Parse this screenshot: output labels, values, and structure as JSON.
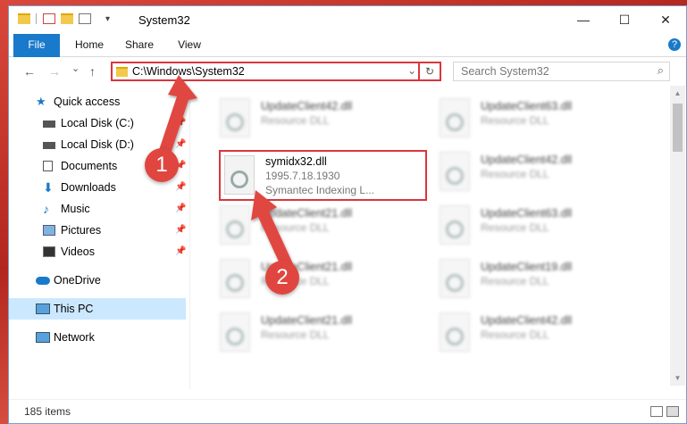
{
  "window": {
    "title": "System32",
    "controls": {
      "minimize": "—",
      "maximize": "☐",
      "close": "✕"
    }
  },
  "ribbon": {
    "tabs": [
      "File",
      "Home",
      "Share",
      "View"
    ],
    "help": "?"
  },
  "nav": {
    "back": "←",
    "forward": "→",
    "recent": "⌄",
    "up": "↑",
    "address": "C:\\Windows\\System32",
    "dropdown": "⌄",
    "refresh": "↻",
    "search_placeholder": "Search System32",
    "search_icon": "⌕"
  },
  "sidebar": {
    "items": [
      {
        "label": "Quick access",
        "icon": "star-icon",
        "pinned": false
      },
      {
        "label": "Local Disk (C:)",
        "icon": "drive-icon",
        "pinned": true
      },
      {
        "label": "Local Disk (D:)",
        "icon": "drive-icon",
        "pinned": true
      },
      {
        "label": "Documents",
        "icon": "document-icon",
        "pinned": true
      },
      {
        "label": "Downloads",
        "icon": "download-icon",
        "pinned": true
      },
      {
        "label": "Music",
        "icon": "music-icon",
        "pinned": true
      },
      {
        "label": "Pictures",
        "icon": "picture-icon",
        "pinned": true
      },
      {
        "label": "Videos",
        "icon": "video-icon",
        "pinned": true
      },
      {
        "label": "OneDrive",
        "icon": "cloud-icon",
        "pinned": false
      },
      {
        "label": "This PC",
        "icon": "computer-icon",
        "pinned": false,
        "selected": true
      },
      {
        "label": "Network",
        "icon": "network-icon",
        "pinned": false
      }
    ],
    "pin_glyph": "📌"
  },
  "files": {
    "left": [
      {
        "name": "UpdateClient42.dll",
        "type": "Resource DLL"
      },
      {
        "name": "UpdateClient21.dll",
        "type": "Resource DLL"
      },
      {
        "name": "UpdateClient21.dll",
        "type": "Resource DLL"
      },
      {
        "name": "UpdateClient21.dll",
        "type": "Resource DLL"
      }
    ],
    "right": [
      {
        "name": "UpdateClient63.dll",
        "type": "Resource DLL"
      },
      {
        "name": "UpdateClient42.dll",
        "type": "Resource DLL"
      },
      {
        "name": "UpdateClient63.dll",
        "type": "Resource DLL"
      },
      {
        "name": "UpdateClient19.dll",
        "type": "Resource DLL"
      },
      {
        "name": "UpdateClient42.dll",
        "type": "Resource DLL"
      }
    ],
    "selected": {
      "name": "symidx32.dll",
      "version": "1995.7.18.1930",
      "description": "Symantec Indexing L..."
    }
  },
  "status": {
    "count": "185 items"
  },
  "annotations": {
    "step1": "1",
    "step2": "2",
    "color": "#e0463f"
  }
}
